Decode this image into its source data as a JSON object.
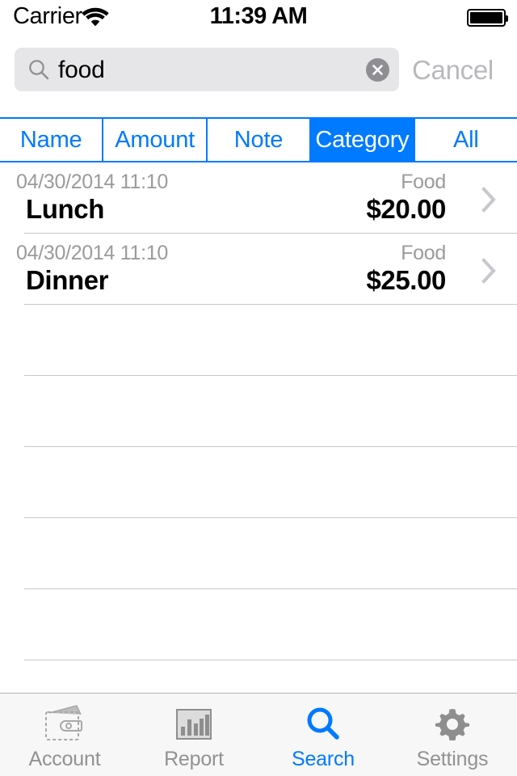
{
  "status_bar": {
    "carrier": "Carrier",
    "wifi_icon": "wifi-icon",
    "time": "11:39 AM",
    "battery_icon": "battery-full-icon"
  },
  "search": {
    "icon": "search-icon",
    "value": "food",
    "placeholder": "Search",
    "clear_icon": "clear-circle-icon",
    "cancel_label": "Cancel"
  },
  "segmented_control": {
    "selected_index": 3,
    "segments": [
      {
        "label": "Name"
      },
      {
        "label": "Amount"
      },
      {
        "label": "Note"
      },
      {
        "label": "Category"
      },
      {
        "label": "All"
      }
    ]
  },
  "list": {
    "rows": [
      {
        "date": "04/30/2014 11:10",
        "title": "Lunch",
        "category": "Food",
        "amount": "$20.00",
        "chevron": "chevron-right-icon"
      },
      {
        "date": "04/30/2014 11:10",
        "title": "Dinner",
        "category": "Food",
        "amount": "$25.00",
        "chevron": "chevron-right-icon"
      }
    ],
    "empty_row_count": 6
  },
  "tab_bar": {
    "active_index": 2,
    "tabs": [
      {
        "label": "Account",
        "icon": "wallet-icon"
      },
      {
        "label": "Report",
        "icon": "bar-chart-icon"
      },
      {
        "label": "Search",
        "icon": "search-icon"
      },
      {
        "label": "Settings",
        "icon": "gear-icon"
      }
    ]
  },
  "colors": {
    "accent": "#007aff",
    "muted_text": "#9b9b9b",
    "separator": "#c8c7cc",
    "search_field_bg": "#e6e6e8",
    "tabbar_bg": "#f7f7f7"
  }
}
